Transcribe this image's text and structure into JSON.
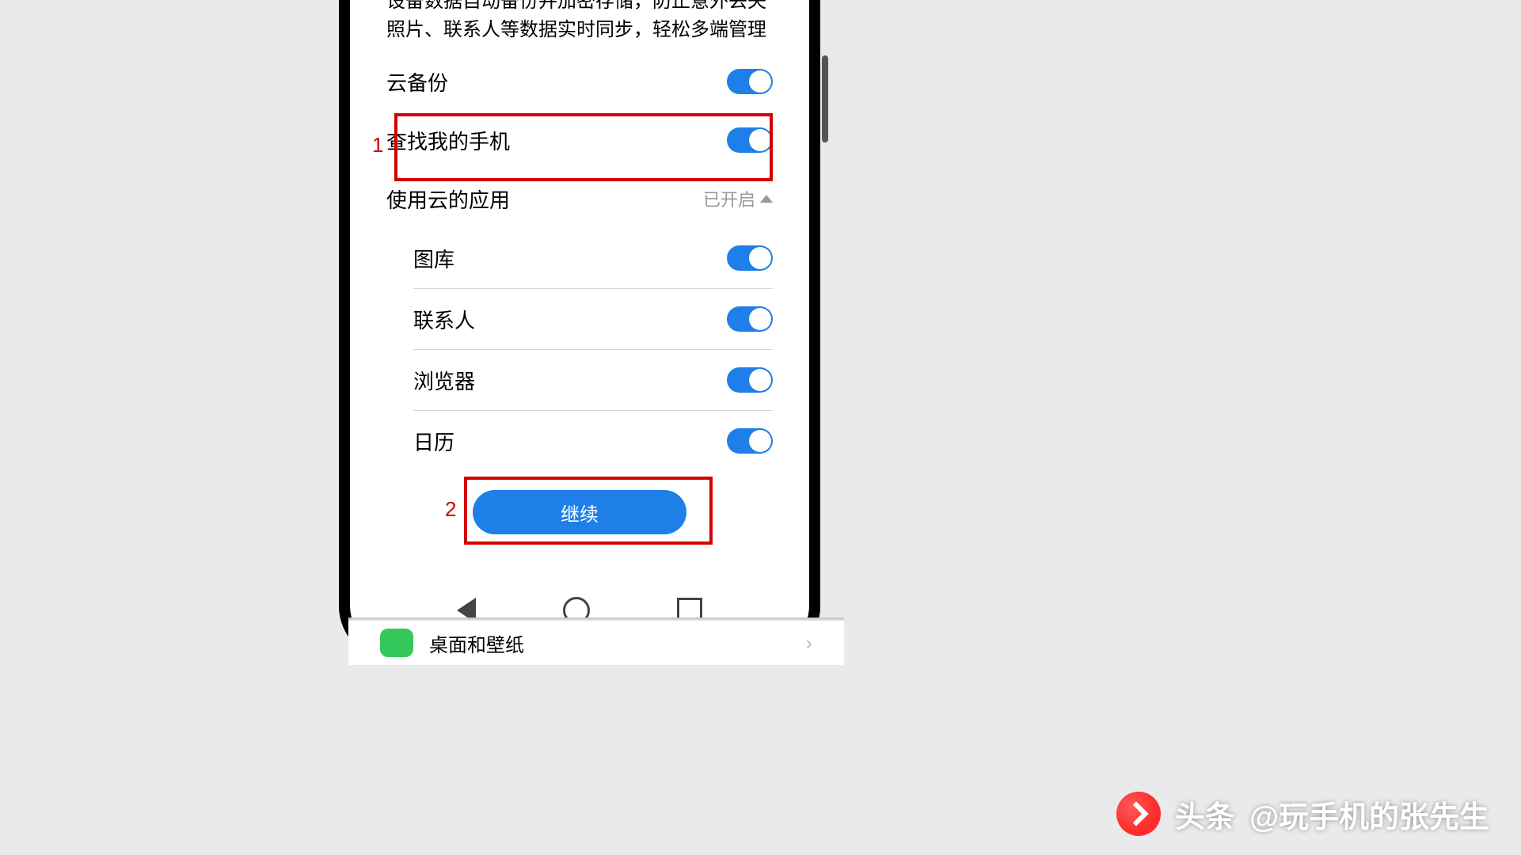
{
  "description": {
    "line1": "设备数据自动备份并加密存储，防止意外丢失",
    "line2": "照片、联系人等数据实时同步，轻松多端管理"
  },
  "rows": {
    "cloud_backup": "云备份",
    "find_my_phone": "查找我的手机"
  },
  "section": {
    "title": "使用云的应用",
    "status": "已开启"
  },
  "apps": {
    "gallery": "图库",
    "contacts": "联系人",
    "browser": "浏览器",
    "calendar": "日历"
  },
  "button_continue": "继续",
  "annotations": {
    "n1": "1",
    "n2": "2"
  },
  "peek": {
    "label": "桌面和壁纸"
  },
  "watermark": {
    "brand": "头条",
    "handle": "@玩手机的张先生"
  }
}
